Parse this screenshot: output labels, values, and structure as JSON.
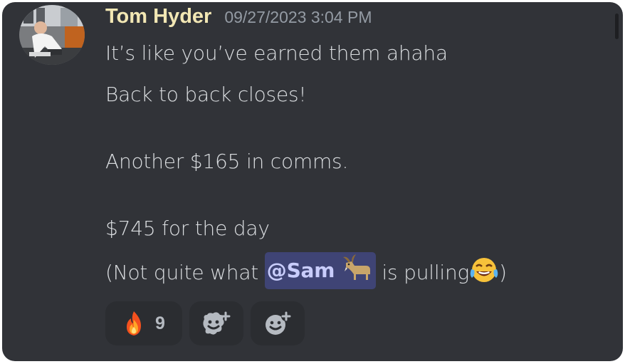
{
  "message": {
    "author": "Tom Hyder",
    "timestamp": "09/27/2023 3:04 PM",
    "lines": {
      "l1": "It’s like you’ve earned them ahaha",
      "l2": "Back to back closes!",
      "l3": "Another $165 in comms.",
      "l4": "$745 for the day",
      "l5_pre": "(Not quite what ",
      "mention": "@Sam",
      "l5_mid": " is pulling",
      "l5_post": ")"
    },
    "mention_emoji": "goat-emoji",
    "trailing_emoji": "laughing-tears-emoji"
  },
  "reactions": [
    {
      "emoji": "fire-emoji",
      "count": "9"
    },
    {
      "emoji": "add-super-reaction-icon"
    },
    {
      "emoji": "add-reaction-icon"
    }
  ],
  "colors": {
    "background": "#313338",
    "author": "#f2e7b4",
    "timestamp": "#949ba4",
    "text": "#dbdee1",
    "mention_bg": "#3f4475",
    "mention_text": "#c9cdfb",
    "reaction_bg": "#2b2d31"
  }
}
